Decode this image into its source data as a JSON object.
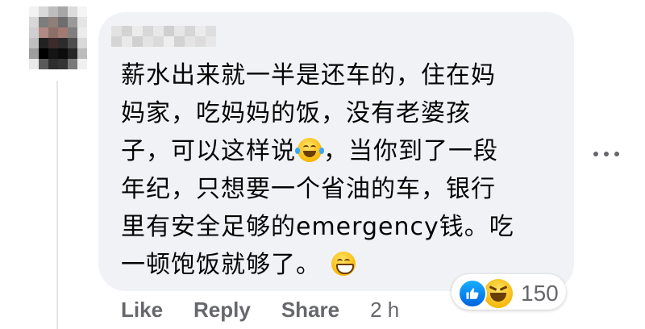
{
  "comment": {
    "lines": [
      "薪水出来就一半是还车的，住在妈",
      "妈家，吃妈妈的饭，没有老婆孩",
      "子，可以这样说",
      "，当你到了一段",
      "年纪，只想要一个省油的车，银行",
      "里有安全足够的emergency钱。吃",
      "一顿饱饭就够了。"
    ]
  },
  "emoji": {
    "laughing_tears": "face-with-tears-of-joy-icon",
    "grinning": "grinning-face-icon"
  },
  "reactions": {
    "count": "150",
    "types": [
      "like-icon",
      "haha-icon"
    ]
  },
  "actions": {
    "like": "Like",
    "reply": "Reply",
    "share": "Share",
    "time": "2 h"
  },
  "colors": {
    "bubble": "#f0f2f5",
    "text": "#050505",
    "secondary": "#65676b",
    "like_blue": "#0866ff"
  }
}
